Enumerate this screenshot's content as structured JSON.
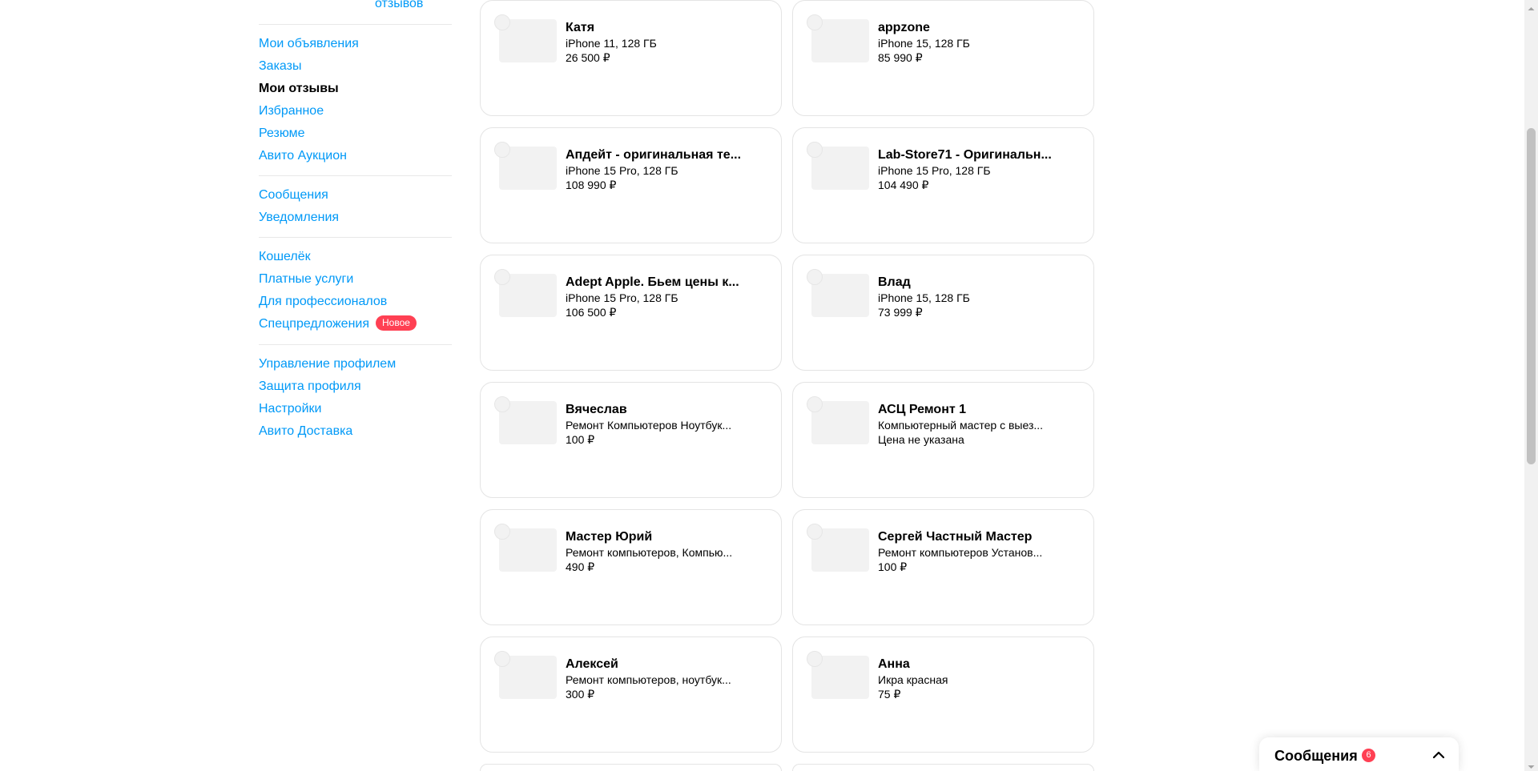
{
  "sidebar": {
    "reviews_link": "отзывов",
    "group1": [
      {
        "label": "Мои объявления",
        "active": false
      },
      {
        "label": "Заказы",
        "active": false
      },
      {
        "label": "Мои отзывы",
        "active": true
      },
      {
        "label": "Избранное",
        "active": false
      },
      {
        "label": "Резюме",
        "active": false
      },
      {
        "label": "Авито Аукцион",
        "active": false
      }
    ],
    "group2": [
      {
        "label": "Сообщения"
      },
      {
        "label": "Уведомления"
      }
    ],
    "group3": [
      {
        "label": "Кошелёк"
      },
      {
        "label": "Платные услуги"
      },
      {
        "label": "Для профессионалов"
      },
      {
        "label": "Спецпредложения",
        "badge": "Новое"
      }
    ],
    "group4": [
      {
        "label": "Управление профилем"
      },
      {
        "label": "Защита профиля"
      },
      {
        "label": "Настройки"
      },
      {
        "label": "Авито Доставка"
      }
    ]
  },
  "cards": [
    {
      "name": "Катя",
      "item": "iPhone 11, 128 ГБ",
      "price": "26 500 ₽"
    },
    {
      "name": "appzone",
      "item": "iPhone 15, 128 ГБ",
      "price": "85 990 ₽"
    },
    {
      "name": "Апдейт - оригинальная те...",
      "item": "iPhone 15 Pro, 128 ГБ",
      "price": "108 990 ₽"
    },
    {
      "name": "Lab-Store71 - Оригинальн...",
      "item": "iPhone 15 Pro, 128 ГБ",
      "price": "104 490 ₽"
    },
    {
      "name": "Adept Apple. Бьем цены к...",
      "item": "iPhone 15 Pro, 128 ГБ",
      "price": "106 500 ₽"
    },
    {
      "name": "Влад",
      "item": "iPhone 15, 128 ГБ",
      "price": "73 999 ₽"
    },
    {
      "name": "Вячеслав",
      "item": "Ремонт Компьютеров Ноутбук...",
      "price": "100 ₽"
    },
    {
      "name": "АСЦ Ремонт 1",
      "item": "Компьютерный мастер с выез...",
      "price": "Цена не указана"
    },
    {
      "name": "Мастер Юрий",
      "item": "Ремонт компьютеров, Компью...",
      "price": "490 ₽"
    },
    {
      "name": "Сергей Частный Мастер",
      "item": "Ремонт компьютеров Установ...",
      "price": "100 ₽"
    },
    {
      "name": "Алексей",
      "item": "Ремонт компьютеров, ноутбук...",
      "price": "300 ₽"
    },
    {
      "name": "Анна",
      "item": "Икра красная",
      "price": "75 ₽"
    }
  ],
  "messages_widget": {
    "title": "Сообщения",
    "count": "6",
    "icon": "chevron-up-icon"
  },
  "colors": {
    "link": "#0099f7",
    "badge": "#ff4053",
    "card_border": "#e4e4e4"
  }
}
